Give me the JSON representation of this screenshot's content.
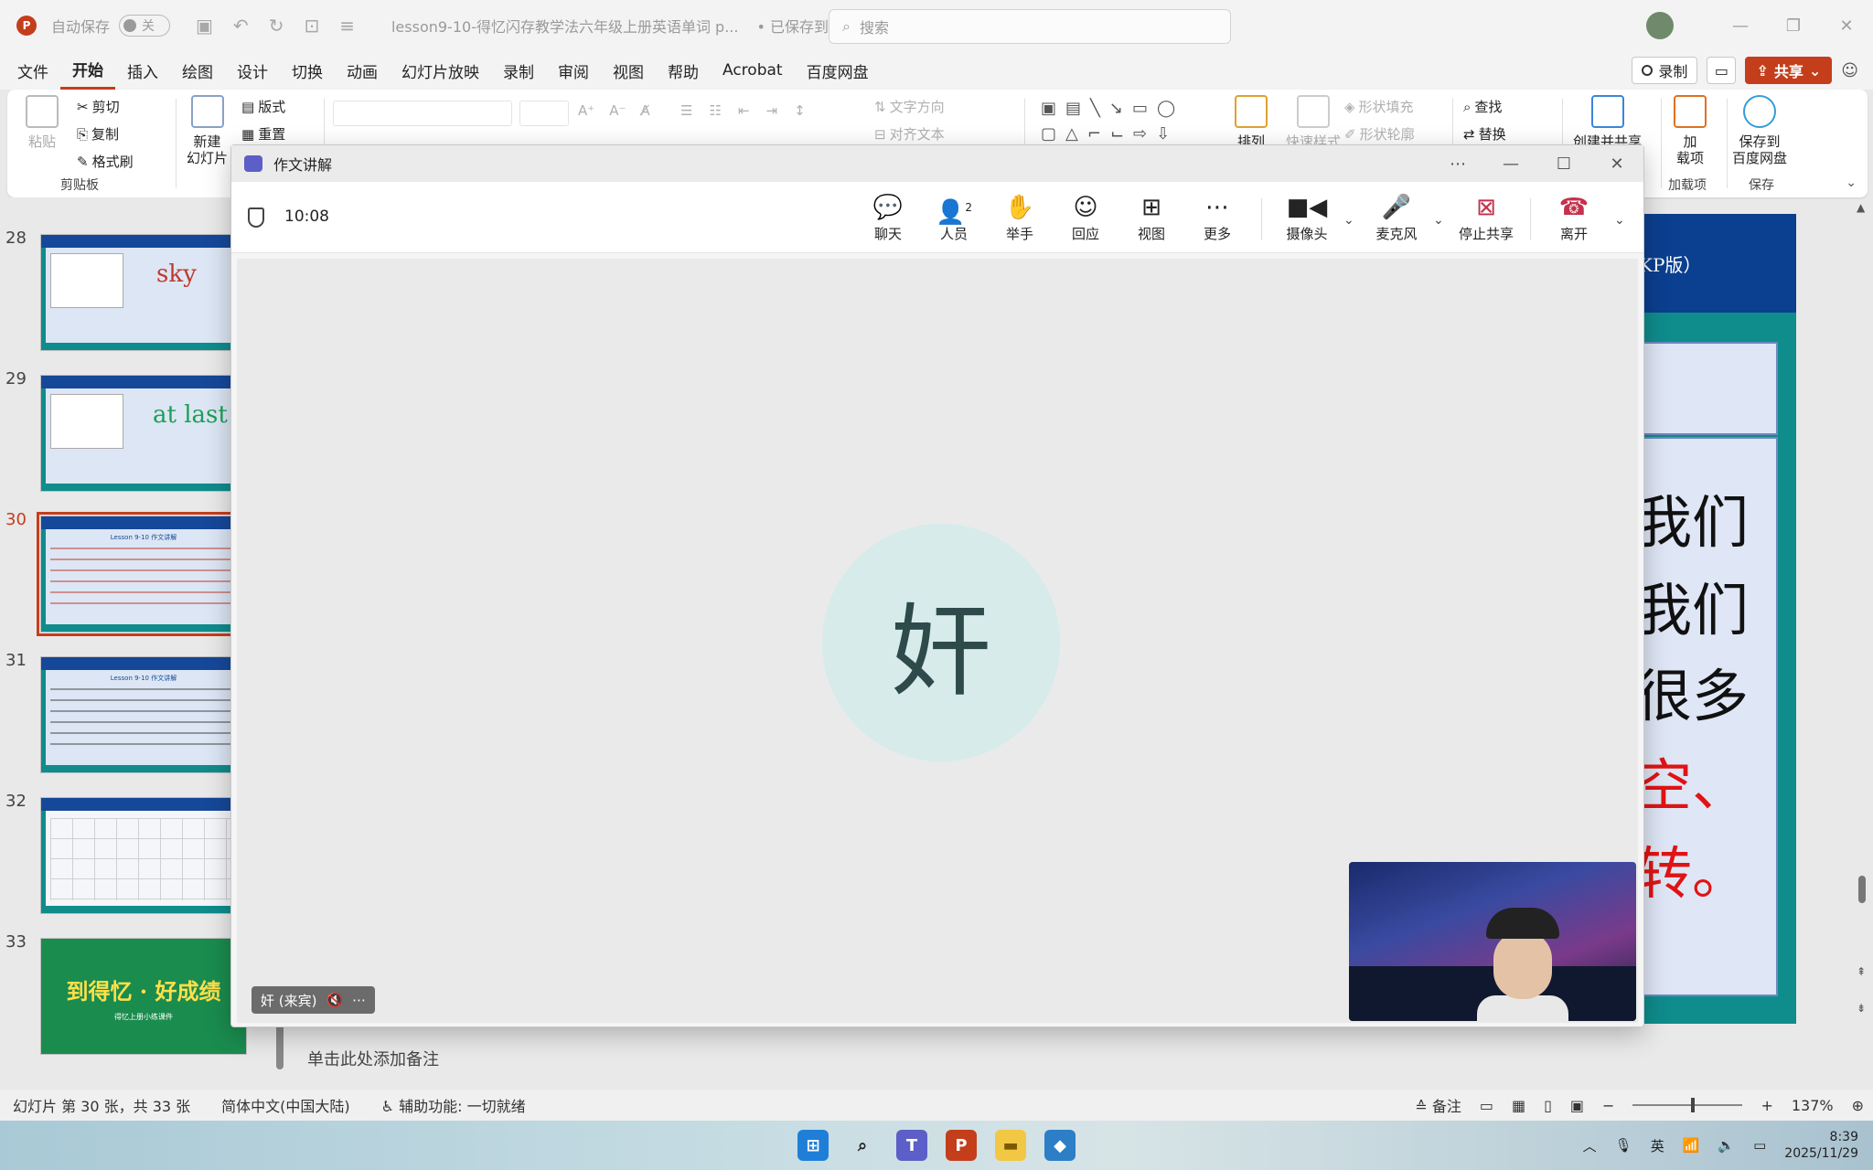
{
  "ppt": {
    "autosave_label": "自动保存",
    "autosave_state": "关",
    "doc_title": "lesson9-10-得忆闪存教学法六年级上册英语单词 p...",
    "saved_status": "• 已保存到这台电脑 ∨",
    "search_placeholder": "搜索"
  },
  "ribbon": {
    "tabs": [
      "文件",
      "开始",
      "插入",
      "绘图",
      "设计",
      "切换",
      "动画",
      "幻灯片放映",
      "录制",
      "审阅",
      "视图",
      "帮助",
      "Acrobat",
      "百度网盘"
    ],
    "record_label": "录制",
    "share_label": "共享",
    "paste_label": "粘贴",
    "cut_label": "剪切",
    "copy_label": "复制",
    "format_painter_label": "格式刷",
    "clipboard_caption": "剪贴板",
    "new_slide_label": "新建\n幻灯片",
    "layout_label": "版式",
    "reset_label": "重置",
    "text_direction_label": "文字方向",
    "align_text_label": "对齐文本",
    "arrange_label": "排列",
    "quick_styles_label": "快速样式",
    "shape_fill_label": "形状填充",
    "shape_outline_label": "形状轮廓",
    "find_label": "查找",
    "replace_label": "替换",
    "create_share_label": "创建并共享",
    "addins_label": "加\n载项",
    "addins_caption": "加载项",
    "save_baidu_label": "保存到\n百度网盘",
    "save_caption": "保存"
  },
  "thumbnails": [
    {
      "num": "28",
      "word": "sky"
    },
    {
      "num": "29",
      "word": "at last"
    },
    {
      "num": "30",
      "title": "Lesson 9-10  作文讲解"
    },
    {
      "num": "31",
      "title": "Lesson 9-10  作文讲解"
    },
    {
      "num": "32"
    },
    {
      "num": "33",
      "big_title": "到得忆 · 好成绩",
      "sub_title": "得忆上册小练课件"
    }
  ],
  "slide": {
    "header_fragment": "（KP版）",
    "lines": [
      "我们",
      "我们",
      "很多",
      "空、",
      "转。"
    ]
  },
  "notes_placeholder": "单击此处添加备注",
  "status": {
    "slide_info": "幻灯片 第 30 张，共 33 张",
    "language": "简体中文(中国大陆)",
    "accessibility": "辅助功能: 一切就绪",
    "notes_label": "备注",
    "zoom": "137%"
  },
  "teams": {
    "window_title": "作文讲解",
    "call_time": "10:08",
    "controls": {
      "chat": "聊天",
      "people": "人员",
      "people_count": "2",
      "raise": "举手",
      "react": "回应",
      "view": "视图",
      "more": "更多",
      "camera": "摄像头",
      "mic": "麦克风",
      "stop_share": "停止共享",
      "leave": "离开"
    },
    "participant_initial": "奸",
    "participant_tag": "奸 (来宾)"
  },
  "taskbar": {
    "ime": "英",
    "time": "8:39",
    "date": "2025/11/29"
  },
  "colors": {
    "ppt_accent": "#c43e1c",
    "teams_purple": "#5b5fc7",
    "slide_teal": "#0f8c8c",
    "slide_header_blue": "#0b3f8f"
  }
}
